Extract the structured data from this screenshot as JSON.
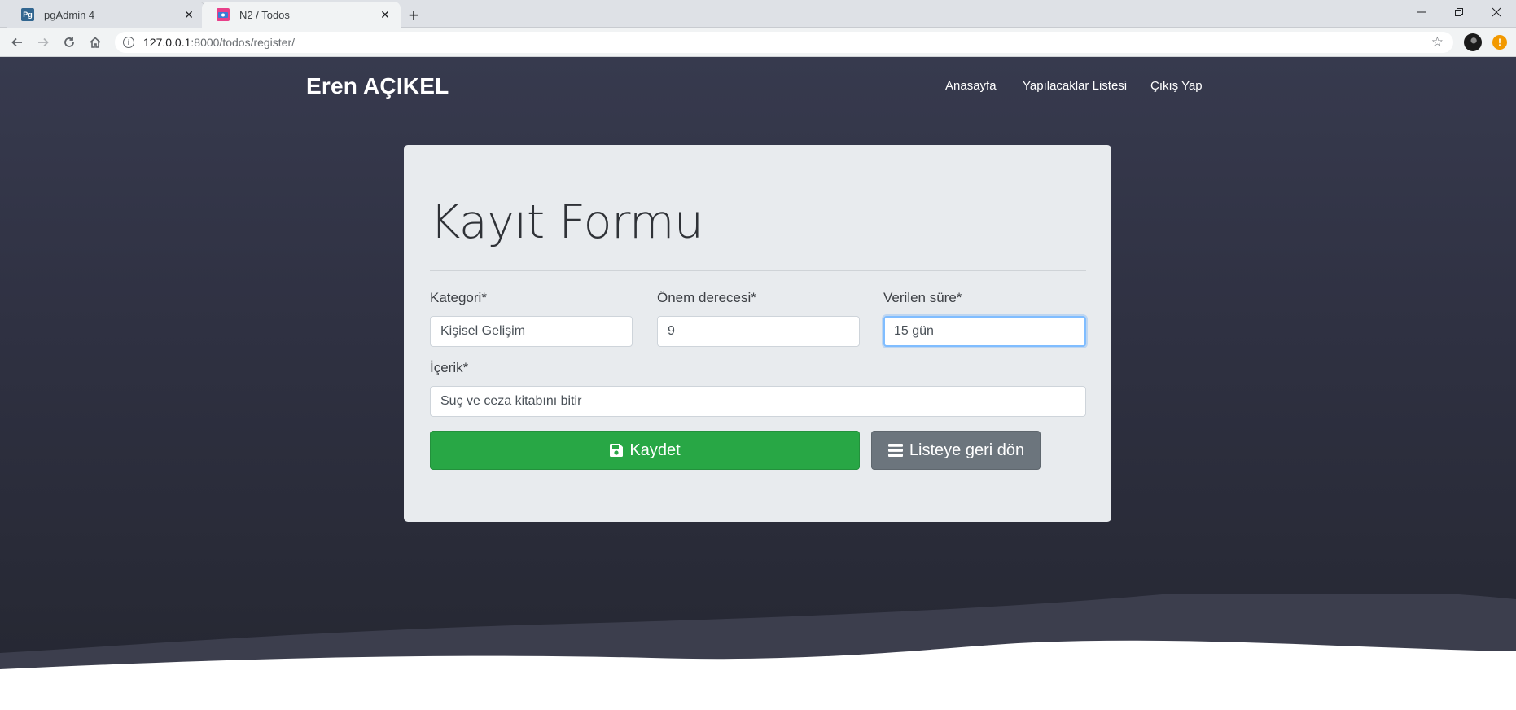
{
  "browser": {
    "tabs": [
      {
        "title": "pgAdmin 4",
        "favicon_text": "Pg",
        "active": false
      },
      {
        "title": "N2 / Todos",
        "active": true
      }
    ],
    "new_tab_label": "+",
    "address": {
      "host": "127.0.0.1",
      "path": ":8000/todos/register/"
    }
  },
  "site": {
    "brand": "Eren AÇIKEL",
    "nav": [
      "Anasayfa",
      "Yapılacaklar Listesi",
      "Çıkış Yap"
    ]
  },
  "form": {
    "title": "Kayıt Formu",
    "fields": {
      "kategori": {
        "label": "Kategori*",
        "value": "Kişisel Gelişim"
      },
      "onem": {
        "label": "Önem derecesi*",
        "value": "9"
      },
      "sure": {
        "label": "Verilen süre*",
        "value": "15 gün"
      },
      "icerik": {
        "label": "İçerik*",
        "value": "Suç ve ceza kitabını bitir"
      }
    },
    "buttons": {
      "save": "Kaydet",
      "back": "Listeye geri dön"
    }
  },
  "colors": {
    "hero_top": "#373a4e",
    "hero_bottom": "#262833",
    "card_bg": "#e8ebee",
    "save": "#28a745",
    "back": "#6c757d",
    "focus_border": "#80bdff"
  },
  "icons": {
    "save": "floppy-disk-icon",
    "back": "list-icon"
  }
}
